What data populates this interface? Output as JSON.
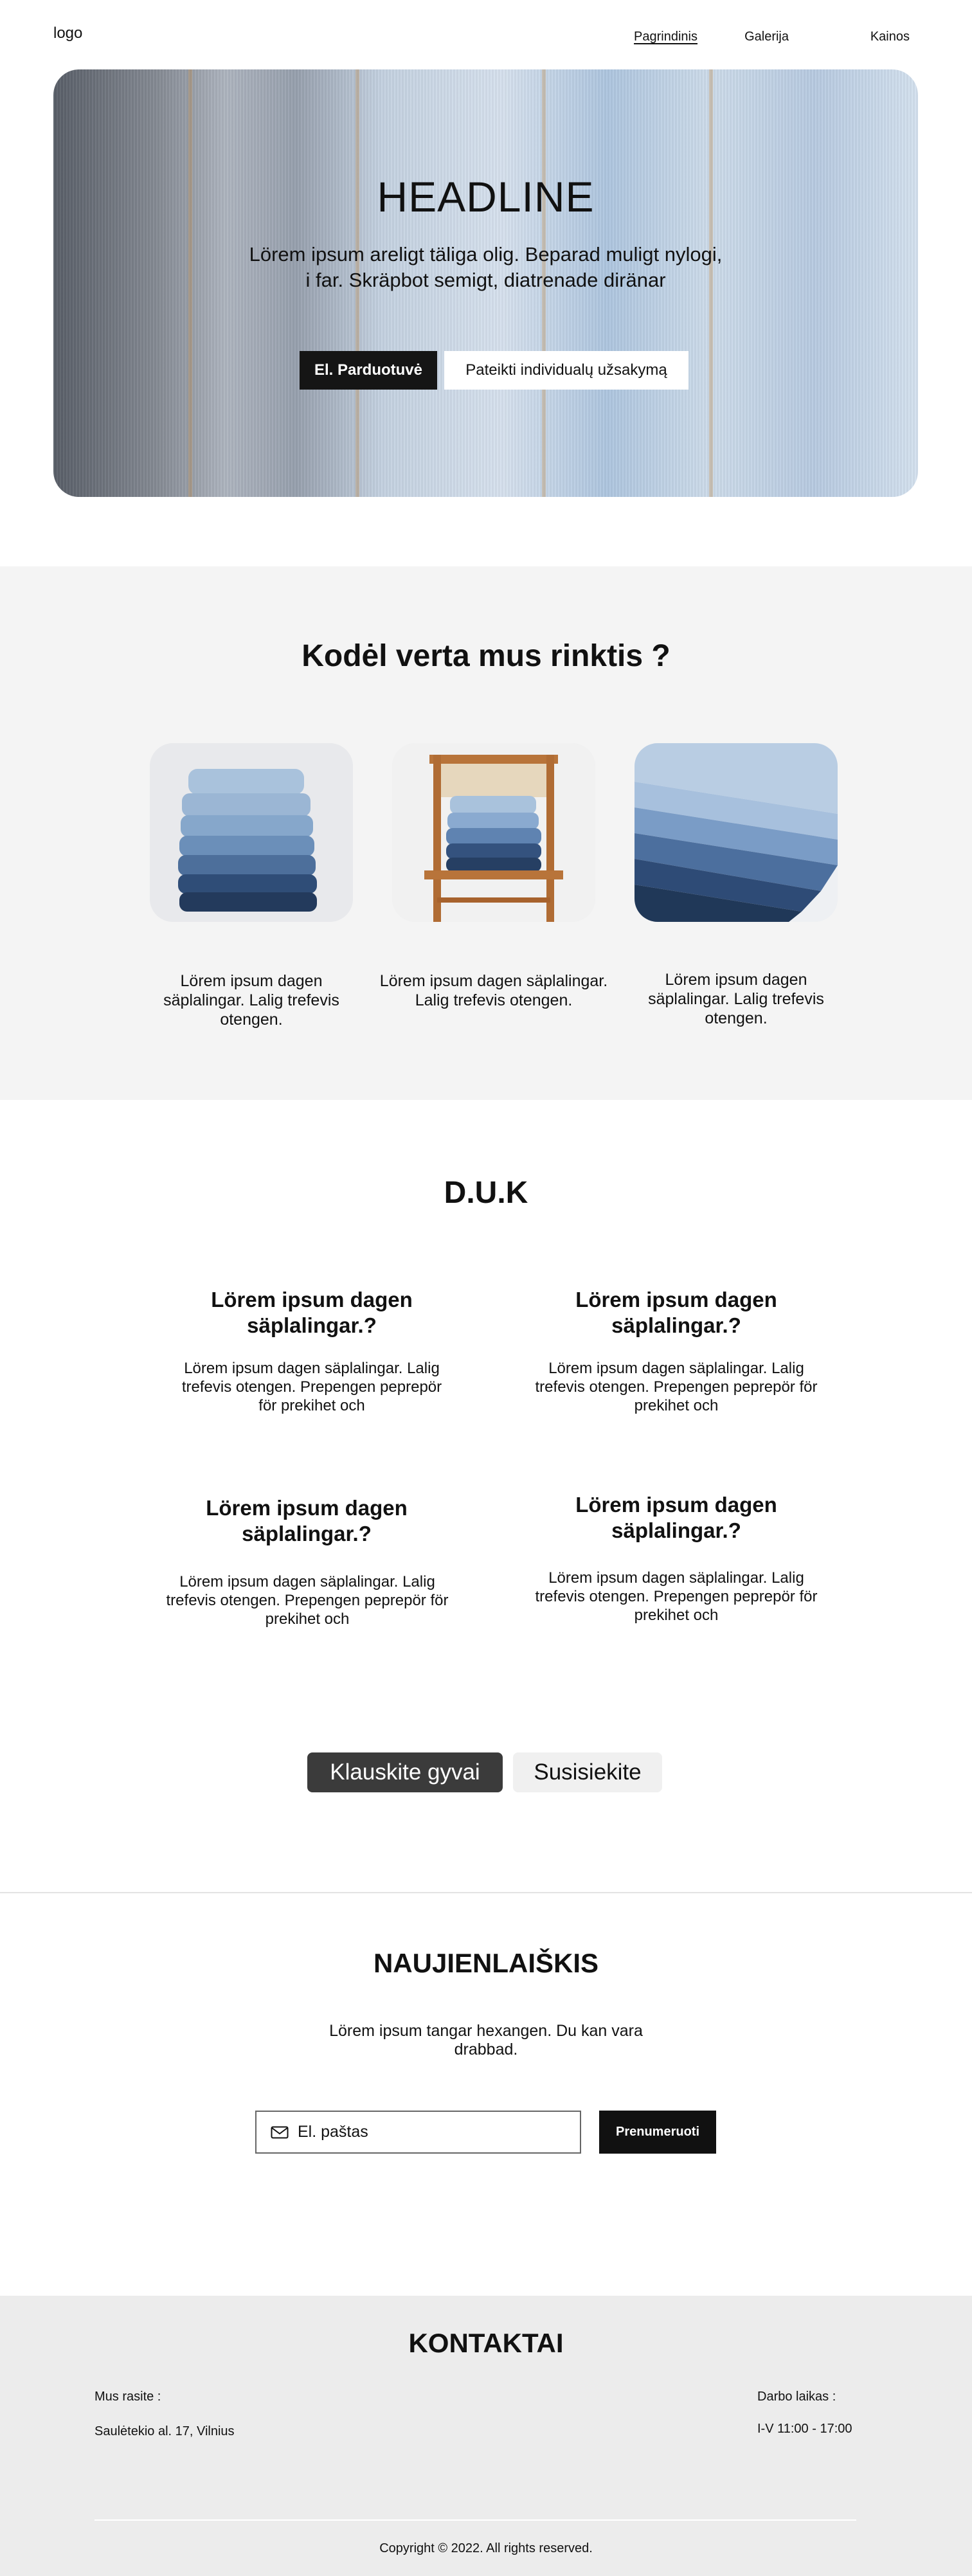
{
  "nav": {
    "logo": "logo",
    "links": [
      "Pagrindinis",
      "Galerija",
      "Kainos"
    ]
  },
  "hero": {
    "headline": "HEADLINE",
    "subtitle": "Lörem ipsum areligt täliga olig. Beparad muligt nylogi, i far. Skräpbot semigt, diatrenade diränar",
    "primary_button": "El. Parduotuvė",
    "secondary_button": "Pateikti individualų užsakymą"
  },
  "why": {
    "title": "Kodėl verta mus rinktis ?",
    "cards": [
      {
        "text": "Lörem ipsum dagen säplalingar. Lalig trefevis otengen."
      },
      {
        "text": "Lörem ipsum dagen säplalingar. Lalig trefevis otengen."
      },
      {
        "text": "Lörem ipsum dagen säplalingar. Lalig trefevis otengen."
      }
    ]
  },
  "faq": {
    "title": "D.U.K",
    "items": [
      {
        "question": "Lörem ipsum dagen säplalingar.?",
        "answer": "Lörem ipsum dagen säplalingar. Lalig trefevis otengen. Prepengen peprepör för prekihet och"
      },
      {
        "question": "Lörem ipsum dagen säplalingar.?",
        "answer": "Lörem ipsum dagen säplalingar. Lalig trefevis otengen. Prepengen peprepör för prekihet och"
      },
      {
        "question": "Lörem ipsum dagen säplalingar.?",
        "answer": "Lörem ipsum dagen säplalingar. Lalig trefevis otengen. Prepengen peprepör för prekihet och"
      },
      {
        "question": "Lörem ipsum dagen säplalingar.?",
        "answer": "Lörem ipsum dagen säplalingar. Lalig trefevis otengen. Prepengen peprepör för prekihet och"
      }
    ],
    "ask_button": "Klauskite gyvai",
    "contact_button": "Susisiekite"
  },
  "newsletter": {
    "title": "NAUJIENLAIŠKIS",
    "text": "Lörem ipsum tangar hexangen. Du kan vara drabbad.",
    "email_placeholder": "El. paštas",
    "subscribe_button": "Prenumeruoti"
  },
  "contacts": {
    "title": "KONTAKTAI",
    "find_label": "Mus rasite :",
    "address": "Saulėtekio al. 17, Vilnius",
    "hours_label": "Darbo laikas :",
    "hours": "I-V 11:00 - 17:00",
    "copyright": "Copyright © 2022. All rights reserved."
  },
  "colors": {
    "dark_button": "#151515",
    "section_gray": "#f4f4f4",
    "footer_gray": "#ececec",
    "ask_button": "#3b3b3b"
  }
}
